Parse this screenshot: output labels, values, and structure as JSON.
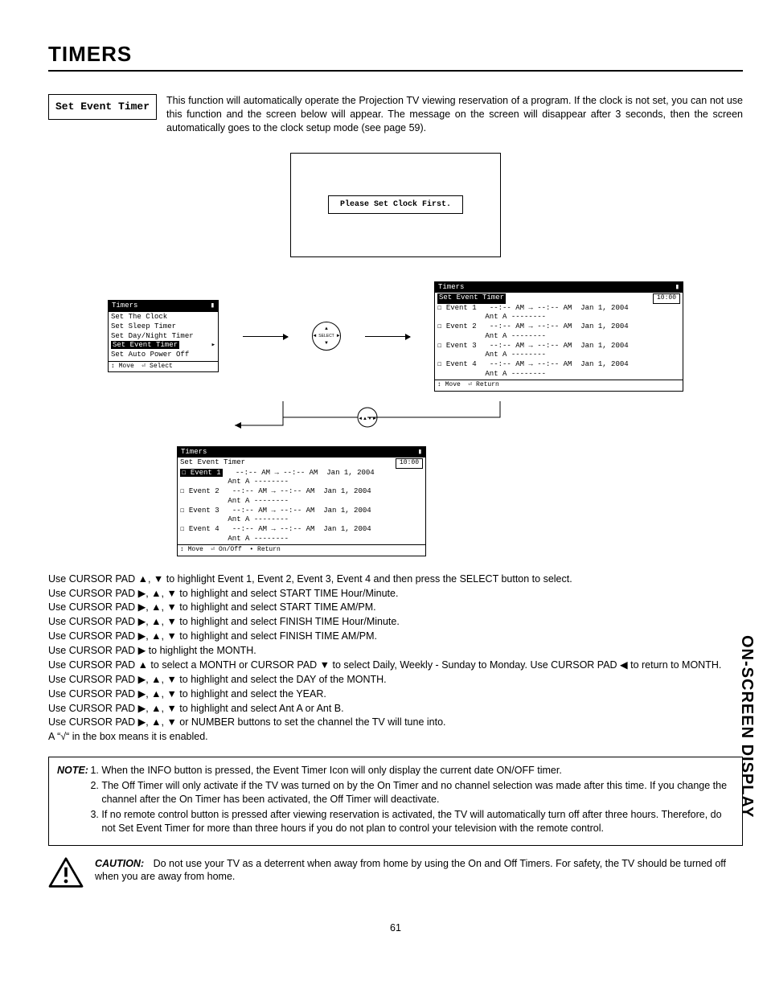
{
  "title": "TIMERS",
  "sideLabel": "ON-SCREEN DISPLAY",
  "tag": "Set Event Timer",
  "intro": "This function will automatically operate the Projection TV viewing reservation of a program.  If the clock is not set, you can not use this function and the screen below will appear.  The message on the screen will disappear after 3 seconds, then the screen automatically goes to the clock setup mode (see page 59).",
  "clockFirst": "Please Set Clock First.",
  "selectBtn": "SELECT",
  "menu1": {
    "header": "Timers",
    "items": [
      "Set The Clock",
      "Set Sleep Timer",
      "Set Day/Night Timer",
      "Set Event Timer",
      "Set Auto Power Off"
    ],
    "highlight": 3,
    "footer": "↕ Move  ⏎ Select"
  },
  "eventScreen": {
    "header": "Timers",
    "sub": "Set Event Timer",
    "clock": "10:00",
    "rows": [
      {
        "n": "Event 1",
        "t": "--:-- AM → --:-- AM  Jan 1, 2004",
        "a": "Ant A --------"
      },
      {
        "n": "Event 2",
        "t": "--:-- AM → --:-- AM  Jan 1, 2004",
        "a": "Ant A --------"
      },
      {
        "n": "Event 3",
        "t": "--:-- AM → --:-- AM  Jan 1, 2004",
        "a": "Ant A --------"
      },
      {
        "n": "Event 4",
        "t": "--:-- AM → --:-- AM  Jan 1, 2004",
        "a": "Ant A --------"
      }
    ],
    "footerA": "↕ Move  ⏎ Return",
    "footerB": "↕ Move  ⏎ On/Off  • Return"
  },
  "instr": [
    "Use CURSOR PAD ▲, ▼ to highlight Event 1, Event 2, Event 3, Event 4 and then press the SELECT button to select.",
    "Use CURSOR PAD ▶, ▲, ▼ to highlight and select START TIME Hour/Minute.",
    "Use CURSOR PAD ▶, ▲, ▼ to highlight and select START TIME AM/PM.",
    "Use CURSOR PAD ▶, ▲, ▼ to highlight and select FINISH TIME Hour/Minute.",
    "Use CURSOR PAD ▶, ▲, ▼ to highlight and select FINISH TIME AM/PM.",
    "Use CURSOR PAD ▶ to highlight the MONTH.",
    "Use CURSOR PAD ▲ to select a MONTH or CURSOR PAD ▼ to select Daily, Weekly - Sunday to Monday.  Use CURSOR PAD ◀ to return to MONTH.",
    "Use CURSOR PAD ▶, ▲, ▼ to highlight and select the DAY of the MONTH.",
    "Use CURSOR PAD ▶, ▲, ▼ to highlight and select the YEAR.",
    "Use CURSOR PAD ▶, ▲, ▼ to highlight and select Ant A or Ant B.",
    "Use CURSOR PAD ▶, ▲, ▼ or NUMBER buttons to set the channel the TV will tune into.",
    "A “√“ in the box means it is enabled."
  ],
  "noteLabel": "NOTE:",
  "notes": [
    "When the INFO button is pressed, the Event Timer Icon will only display the current date ON/OFF timer.",
    "The Off Timer will only activate if the TV was turned on by the On Timer and no channel selection was made after this time.  If you change the channel after the On Timer has been activated, the Off Timer will deactivate.",
    "If no remote control button is pressed after viewing reservation is activated, the TV will automatically turn off after three hours.  Therefore, do not Set Event Timer for more than three hours if you do not plan to control your television with the remote control."
  ],
  "cautionLabel": "CAUTION:",
  "caution": "Do not use your TV as a deterrent when away from home by using the On and Off Timers.  For safety, the TV should be turned off when you are away from home.",
  "pageNumber": "61"
}
